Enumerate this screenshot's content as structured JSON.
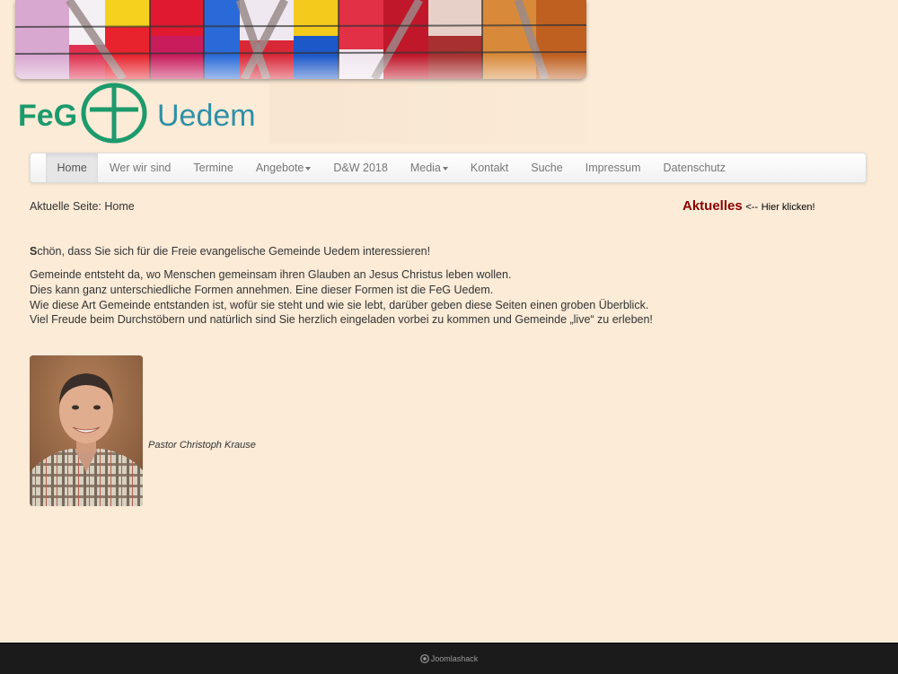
{
  "header": {
    "logo_main": "FeG",
    "logo_city": "Uedem"
  },
  "nav": {
    "items": [
      {
        "label": "Home",
        "active": true,
        "dropdown": false
      },
      {
        "label": "Wer wir sind",
        "active": false,
        "dropdown": false
      },
      {
        "label": "Termine",
        "active": false,
        "dropdown": false
      },
      {
        "label": "Angebote",
        "active": false,
        "dropdown": true
      },
      {
        "label": "D&W 2018",
        "active": false,
        "dropdown": false
      },
      {
        "label": "Media",
        "active": false,
        "dropdown": true
      },
      {
        "label": "Kontakt",
        "active": false,
        "dropdown": false
      },
      {
        "label": "Suche",
        "active": false,
        "dropdown": false
      },
      {
        "label": "Impressum",
        "active": false,
        "dropdown": false
      },
      {
        "label": "Datenschutz",
        "active": false,
        "dropdown": false
      }
    ]
  },
  "breadcrumb": {
    "text": "Aktuelle Seite: Home"
  },
  "sidebar": {
    "link": "Aktuelles",
    "arrow": "<--",
    "hint": "Hier klicken!"
  },
  "content": {
    "intro_first": "S",
    "intro_rest": "chön, dass Sie sich für die Freie evangelische Gemeinde Uedem interessieren!",
    "lines": [
      "Gemeinde entsteht da, wo Menschen gemeinsam ihren Glauben an Jesus Christus leben wollen.",
      "Dies kann ganz unterschiedliche Formen annehmen. Eine dieser Formen ist die FeG Uedem.",
      "Wie diese Art Gemeinde entstanden ist, wofür sie steht und wie sie lebt, darüber geben diese Seiten einen groben Überblick.",
      "Viel Freude beim Durchstöbern und natürlich sind Sie herzlich eingeladen vorbei zu kommen und Gemeinde „live“ zu erleben!"
    ],
    "caption": "Pastor Christoph Krause"
  },
  "footer": {
    "brand": "Joomlashack"
  },
  "colors": {
    "background": "#fbebd7",
    "logo_green": "#1d9a6c",
    "logo_blue": "#2e8fa7",
    "aktuelles_red": "#8b0000",
    "footer": "#1b1b1b"
  }
}
